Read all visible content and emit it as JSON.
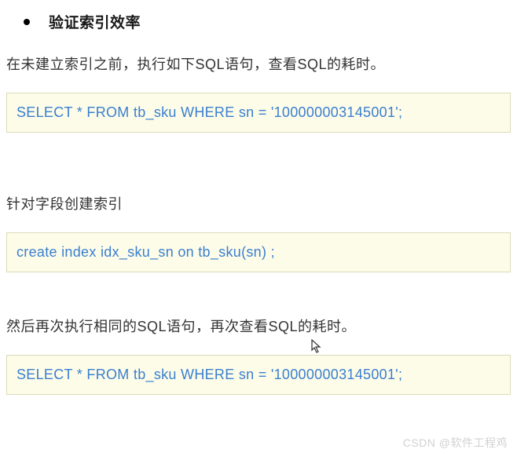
{
  "heading": "验证索引效率",
  "paragraph1": "在未建立索引之前，执行如下SQL语句，查看SQL的耗时。",
  "code1": "SELECT * FROM  tb_sku  WHERE sn = '100000003145001';",
  "paragraph2": "针对字段创建索引",
  "code2": "create  index  idx_sku_sn  on  tb_sku(sn) ;",
  "paragraph3": "然后再次执行相同的SQL语句，再次查看SQL的耗时。",
  "code3": "SELECT * FROM  tb_sku  WHERE sn = '100000003145001';",
  "watermark": "CSDN @软件工程鸡"
}
